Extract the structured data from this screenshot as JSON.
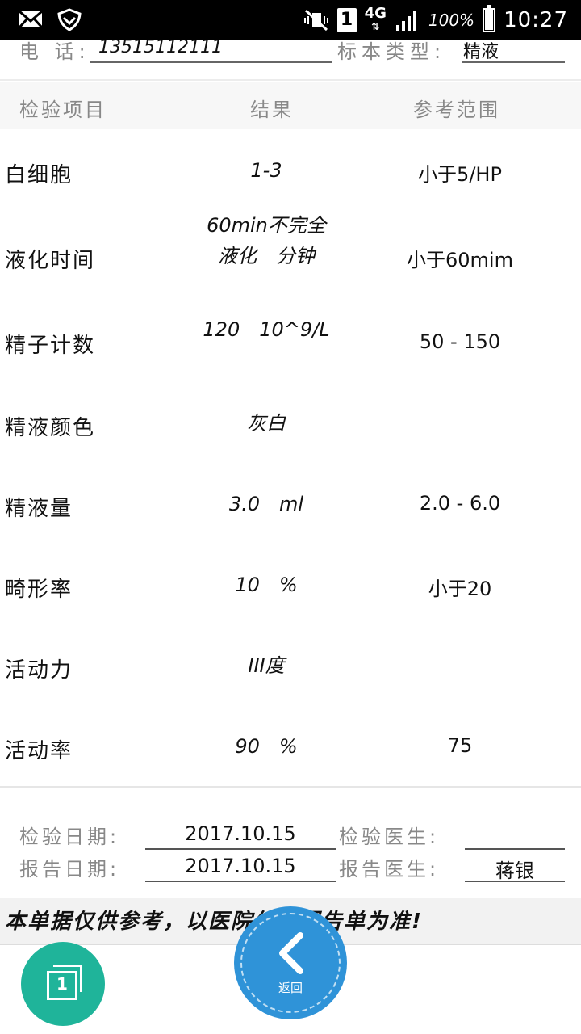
{
  "status_bar": {
    "sim_slot": "1",
    "network": "4G",
    "battery_percent": "100%",
    "battery_level": 1.0,
    "time": "10:27"
  },
  "info_top": {
    "phone_label": "电 话:",
    "phone_value": "13515112111",
    "sample_type_label": "标本类型:",
    "sample_type_value": "精液"
  },
  "table": {
    "headers": [
      "检验项目",
      "结果",
      "参考范围"
    ],
    "rows": [
      {
        "name": "白细胞",
        "result": "1-3",
        "reference": "小于5/HP"
      },
      {
        "name": "液化时间",
        "result": "60min不完全液化　分钟",
        "reference": "小于60mim"
      },
      {
        "name": "精子计数",
        "result": "120　10^9/L",
        "reference": "50 - 150"
      },
      {
        "name": "精液颜色",
        "result": "灰白",
        "reference": ""
      },
      {
        "name": "精液量",
        "result": "3.0　ml",
        "reference": "2.0 - 6.0"
      },
      {
        "name": "畸形率",
        "result": "10　%",
        "reference": "小于20"
      },
      {
        "name": "活动力",
        "result": "III度",
        "reference": ""
      },
      {
        "name": "活动率",
        "result": "90　%",
        "reference": "75"
      }
    ]
  },
  "footer": {
    "test_date_label": "检验日期:",
    "test_date_value": "2017.10.15",
    "test_doctor_label": "检验医生:",
    "test_doctor_value": "",
    "report_date_label": "报告日期:",
    "report_date_value": "2017.10.15",
    "report_doctor_label": "报告医生:",
    "report_doctor_value": "蒋银"
  },
  "notice": "本单据仅供参考，以医院纸质报告单为准!",
  "buttons": {
    "page_count": "1",
    "back_label": "返回"
  }
}
